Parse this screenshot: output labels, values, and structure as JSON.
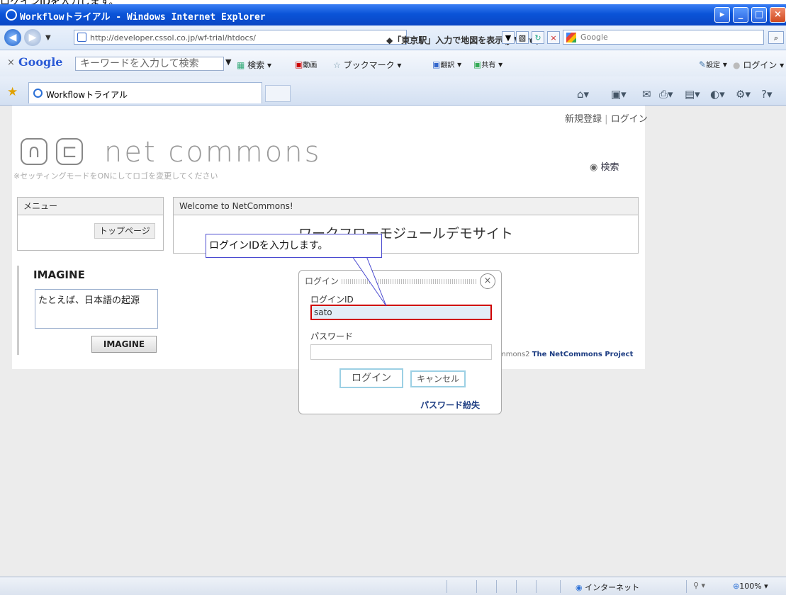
{
  "top_caption": "ログインIDを入力します。",
  "window": {
    "title": "Workflowトライアル - Windows Internet Explorer"
  },
  "address_bar": {
    "url": "http://developer.cssol.co.jp/wf-trial/htdocs/",
    "ad_text": "◆「東京駅」入力で地図を表示(JWord)",
    "search_placeholder": "Google"
  },
  "google_toolbar": {
    "close": "×",
    "logo": "Google",
    "search_placeholder": "キーワードを入力して検索",
    "search_btn": "検索",
    "video": "動画",
    "bookmarks": "ブックマーク",
    "translate": "翻訳",
    "share": "共有",
    "settings": "設定",
    "login": "ログイン"
  },
  "tabs": [
    {
      "label": "Workflowトライアル"
    }
  ],
  "page": {
    "header_links": {
      "register": "新規登録",
      "separator": "|",
      "login": "ログイン"
    },
    "logo_text": "net commons",
    "logo_note": "※セッティングモードをONにしてロゴを変更してください",
    "search_link": "検索",
    "menu": {
      "title": "メニュー",
      "items": [
        "トップページ"
      ]
    },
    "welcome": {
      "title": "Welcome to NetCommons!",
      "body": "ワークフローモジュールデモサイト"
    },
    "imagine": {
      "title": "IMAGINE",
      "text": "たとえば、日本語の起源",
      "button": "IMAGINE"
    },
    "footer": {
      "prefix": "tCommons2",
      "project": "The NetCommons Project"
    }
  },
  "login_dialog": {
    "title": "ログイン",
    "login_id_label": "ログインID",
    "login_id_value": "sato",
    "password_label": "パスワード",
    "login_button": "ログイン",
    "cancel_button": "キャンセル",
    "lost_password": "パスワード紛失"
  },
  "callout": {
    "text": "ログインIDを入力します。"
  },
  "status_bar": {
    "zone": "インターネット",
    "zoom": "100%"
  },
  "colors": {
    "highlight_border": "#d00000",
    "callout_border": "#4a4ad0",
    "titlebar": "#0a54d8"
  }
}
